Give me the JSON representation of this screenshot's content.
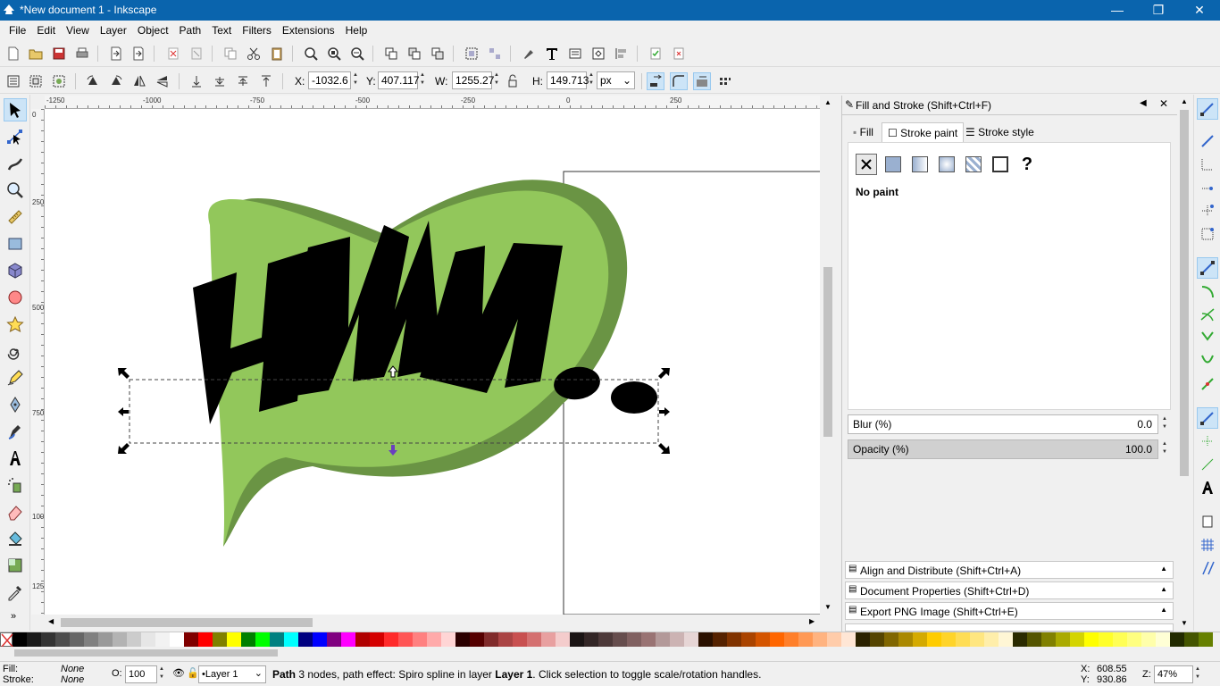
{
  "window": {
    "title": "*New document 1 - Inkscape",
    "minimize": "—",
    "restore": "❐",
    "close": "✕"
  },
  "menubar": {
    "items": [
      "File",
      "Edit",
      "View",
      "Layer",
      "Object",
      "Path",
      "Text",
      "Filters",
      "Extensions",
      "Help"
    ]
  },
  "selectbar": {
    "x_label": "X:",
    "x_value": "-1032.6",
    "y_label": "Y:",
    "y_value": "407.117",
    "w_label": "W:",
    "w_value": "1255.27",
    "h_label": "H:",
    "h_value": "149.713",
    "unit": "px"
  },
  "rulers": {
    "top": [
      "-1250",
      "-1000",
      "-750",
      "-500",
      "-250",
      "0",
      "250"
    ],
    "left": [
      "0",
      "250",
      "500",
      "750",
      "1000",
      "1250"
    ]
  },
  "canvas": {
    "text": "HMM.",
    "bubble_color": "#92c75b",
    "bubble_shadow_color": "#6a9444"
  },
  "dock": {
    "title": "Fill and Stroke (Shift+Ctrl+F)",
    "tabs": {
      "fill": "Fill",
      "stroke_paint": "Stroke paint",
      "stroke_style": "Stroke style"
    },
    "paint_status": "No paint",
    "unknown_glyph": "?",
    "blur_label": "Blur (%)",
    "blur_value": "0.0",
    "opacity_label": "Opacity (%)",
    "opacity_value": "100.0",
    "collapsed": [
      "Align and Distribute (Shift+Ctrl+A)",
      "Document Properties (Shift+Ctrl+D)",
      "Export PNG Image (Shift+Ctrl+E)"
    ]
  },
  "status": {
    "fill_label": "Fill:",
    "fill_value": "None",
    "stroke_label": "Stroke:",
    "stroke_value": "None",
    "opacity_label": "O:",
    "opacity_value": "100",
    "layer": "•Layer 1",
    "message_bold": "Path",
    "message_rest": " 3 nodes, path effect: Spiro spline in layer ",
    "message_layer": "Layer 1",
    "message_tail": ". Click selection to toggle scale/rotation handles.",
    "cursor_x_label": "X:",
    "cursor_x": "608.55",
    "cursor_y_label": "Y:",
    "cursor_y": "930.86",
    "zoom_label": "Z:",
    "zoom_value": "47%"
  },
  "palette": [
    "#000000",
    "#1a1a1a",
    "#333333",
    "#4d4d4d",
    "#666666",
    "#808080",
    "#999999",
    "#b3b3b3",
    "#cccccc",
    "#e6e6e6",
    "#f2f2f2",
    "#ffffff",
    "#800000",
    "#ff0000",
    "#808000",
    "#ffff00",
    "#008000",
    "#00ff00",
    "#008080",
    "#00ffff",
    "#000080",
    "#0000ff",
    "#800080",
    "#ff00ff",
    "#b00000",
    "#d40000",
    "#ff2a2a",
    "#ff5555",
    "#ff8080",
    "#ffaaaa",
    "#ffd5d5",
    "#2b0000",
    "#550000",
    "#802b2b",
    "#aa4444",
    "#c85050",
    "#d47070",
    "#e8a0a0",
    "#f4cccc",
    "#1a1414",
    "#332626",
    "#4d3939",
    "#664d4d",
    "#806060",
    "#997373",
    "#b39999",
    "#ccb3b3",
    "#e6d5d5",
    "#2b1100",
    "#552200",
    "#803300",
    "#aa4400",
    "#d45500",
    "#ff6600",
    "#ff7f2a",
    "#ff9955",
    "#ffb380",
    "#ffccaa",
    "#ffe6d5",
    "#2b2200",
    "#554400",
    "#806600",
    "#aa8800",
    "#d4aa00",
    "#ffcc00",
    "#ffd42a",
    "#ffdd55",
    "#ffe680",
    "#ffeeaa",
    "#fff6d5",
    "#2b2b00",
    "#555500",
    "#808000",
    "#aaaa00",
    "#d4d400",
    "#ffff00",
    "#ffff2a",
    "#ffff55",
    "#ffff80",
    "#ffffaa",
    "#ffffd5",
    "#222b00",
    "#445500",
    "#668000"
  ]
}
